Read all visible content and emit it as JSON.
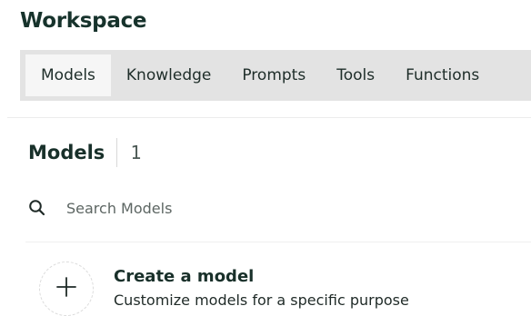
{
  "header": {
    "title": "Workspace"
  },
  "tabs": [
    {
      "label": "Models",
      "active": true
    },
    {
      "label": "Knowledge",
      "active": false
    },
    {
      "label": "Prompts",
      "active": false
    },
    {
      "label": "Tools",
      "active": false
    },
    {
      "label": "Functions",
      "active": false
    }
  ],
  "section": {
    "title": "Models",
    "count": "1"
  },
  "search": {
    "icon": "search-icon",
    "placeholder": "Search Models",
    "value": ""
  },
  "create": {
    "icon": "plus-icon",
    "title": "Create a model",
    "subtitle": "Customize models for a specific purpose"
  },
  "colors": {
    "tabbar_bg": "#e3e3e3",
    "active_tab_bg": "#f6f6f6",
    "title": "#17332c"
  }
}
